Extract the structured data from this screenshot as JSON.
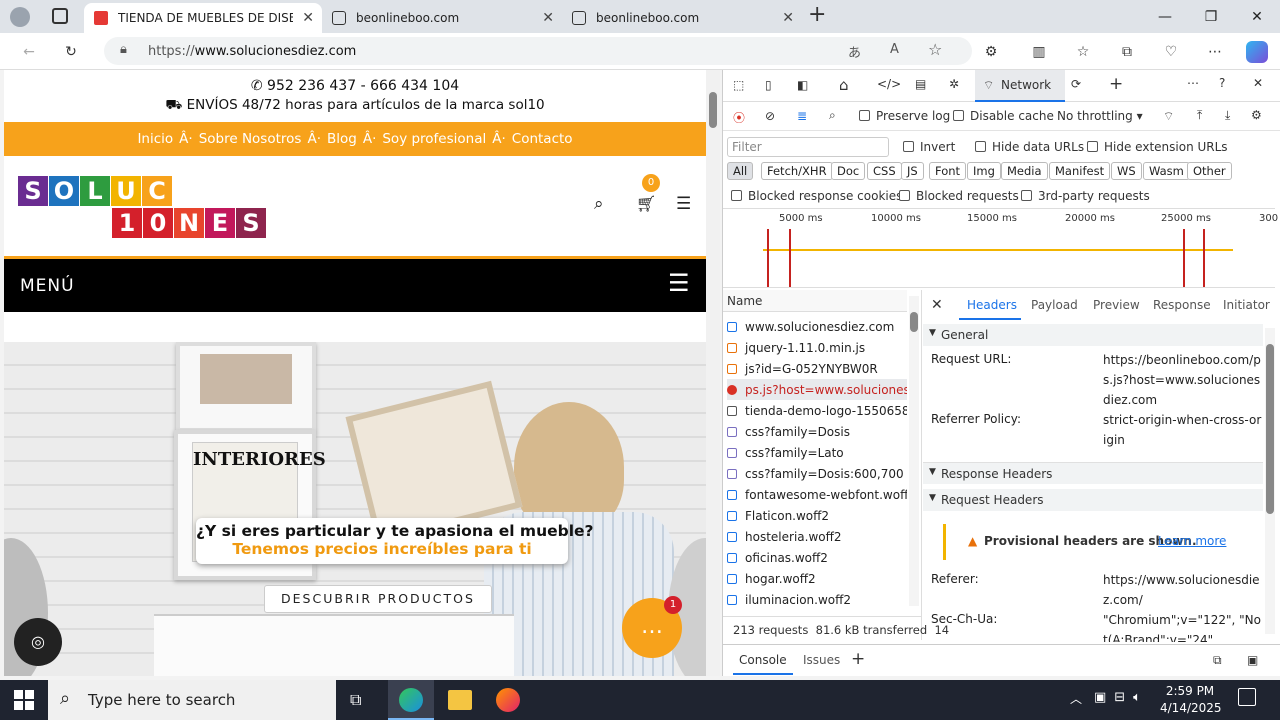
{
  "browser": {
    "tabs": [
      {
        "title": "TIENDA DE MUEBLES DE DISEÑO",
        "active": true
      },
      {
        "title": "beonlineboo.com",
        "active": false
      },
      {
        "title": "beonlineboo.com",
        "active": false
      }
    ],
    "new_tab": "+",
    "url_prefix": "https://",
    "url_domain": "www.solucionesdiez.com"
  },
  "site": {
    "phone": "952 236 437 - 666 434 104",
    "shipping": "ENVÍOS 48/72 horas para artículos de la marca sol10",
    "nav": [
      "Inicio",
      "Â·",
      "Sobre Nosotros",
      "Â·",
      "Blog",
      "Â·",
      "Soy profesional",
      "Â·",
      "Contacto"
    ],
    "logo_top": [
      "S",
      "O",
      "L",
      "U",
      "C"
    ],
    "logo_bottom": [
      "1",
      "0",
      "N",
      "E",
      "S"
    ],
    "cart_count": "0",
    "menu_label": "MENÚ",
    "magazine": "INTERIORES",
    "banner_line1": "¿Y si eres particular y te apasiona el mueble?",
    "banner_line2": "Tenemos precios increíbles  para ti",
    "cta": "DESCUBRIR PRODUCTOS",
    "chat_badge": "1"
  },
  "devtools": {
    "active_tab": "Network",
    "filter_placeholder": "Filter",
    "preserve_log": "Preserve log",
    "disable_cache": "Disable cache",
    "throttling": "No throttling",
    "invert": "Invert",
    "hide_data": "Hide data URLs",
    "hide_ext": "Hide extension URLs",
    "types": [
      "All",
      "Fetch/XHR",
      "Doc",
      "CSS",
      "JS",
      "Font",
      "Img",
      "Media",
      "Manifest",
      "WS",
      "Wasm",
      "Other"
    ],
    "blocked_cookies": "Blocked response cookies",
    "blocked_requests": "Blocked requests",
    "third_party": "3rd-party requests",
    "timeline_ticks": [
      "5000 ms",
      "10000 ms",
      "15000 ms",
      "20000 ms",
      "25000 ms",
      "300"
    ],
    "name_header": "Name",
    "requests": [
      "www.solucionesdiez.com",
      "jquery-1.11.0.min.js",
      "js?id=G-052YNYBW0R",
      "ps.js?host=www.soluciones...",
      "tienda-demo-logo-1550658...",
      "css?family=Dosis",
      "css?family=Lato",
      "css?family=Dosis:600,700",
      "fontawesome-webfont.woff...",
      "Flaticon.woff2",
      "hosteleria.woff2",
      "oficinas.woff2",
      "hogar.woff2",
      "iluminacion.woff2"
    ],
    "detail_tabs": [
      "Headers",
      "Payload",
      "Preview",
      "Response",
      "Initiator"
    ],
    "general": "General",
    "request_url_key": "Request URL:",
    "request_url_val": "https://beonlineboo.com/ps.js?host=www.solucionesdiez.com",
    "referrer_policy_key": "Referrer Policy:",
    "referrer_policy_val": "strict-origin-when-cross-origin",
    "response_headers": "Response Headers",
    "request_headers": "Request Headers",
    "provisional": "Provisional headers are shown.",
    "learn_more": "Learn more",
    "referer_key": "Referer:",
    "referer_val": "https://www.solucionesdiez.com/",
    "secchua_key": "Sec-Ch-Ua:",
    "secchua_val": "\"Chromium\";v=\"122\", \"Not(A:Brand\";v=\"24\"",
    "status": "213 requests  81.6 kB transferred  14",
    "drawer_tabs": [
      "Console",
      "Issues"
    ]
  },
  "taskbar": {
    "search_placeholder": "Type here to search",
    "time": "2:59 PM",
    "date": "4/14/2025"
  }
}
